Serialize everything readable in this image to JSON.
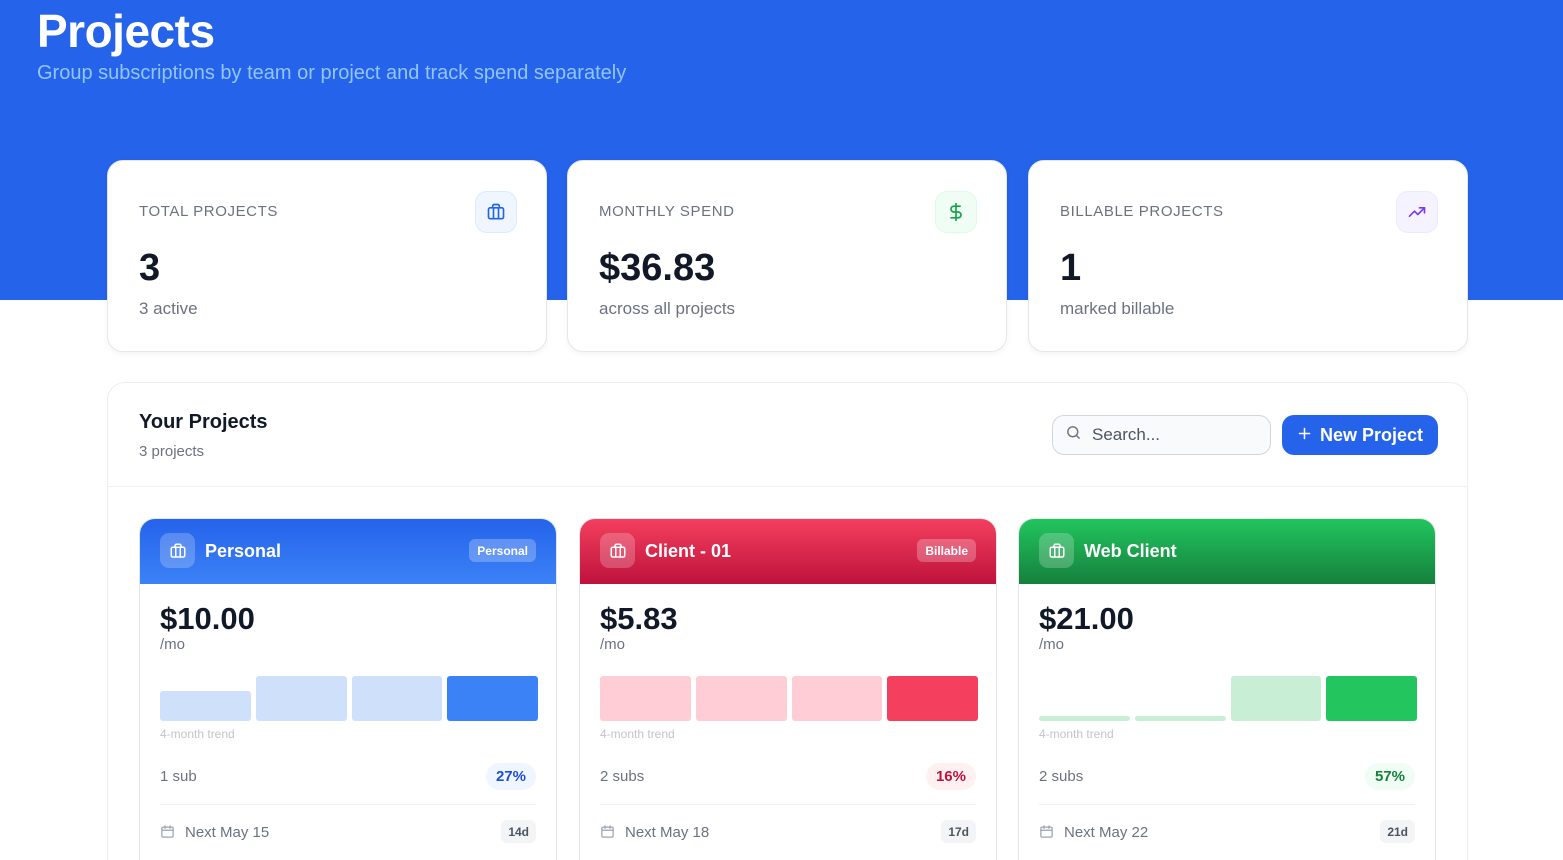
{
  "header": {
    "title": "Projects",
    "subtitle": "Group subscriptions by team or project and track spend separately"
  },
  "stats": [
    {
      "label": "TOTAL PROJECTS",
      "value": "3",
      "note": "3 active",
      "icon": "briefcase-icon",
      "color": "#2563eb"
    },
    {
      "label": "MONTHLY SPEND",
      "value": "$36.83",
      "note": "across all projects",
      "icon": "dollar-icon",
      "color": "#16a34a"
    },
    {
      "label": "BILLABLE PROJECTS",
      "value": "1",
      "note": "marked billable",
      "icon": "trending-up-icon",
      "color": "#7c3aed"
    }
  ],
  "panel": {
    "title": "Your Projects",
    "count": "3 projects",
    "search_placeholder": "Search...",
    "new_button": "New Project"
  },
  "projects": [
    {
      "name": "Personal",
      "tag": "Personal",
      "price": "$10.00",
      "per": "/mo",
      "trend_label": "4-month trend",
      "trend": [
        0.67,
        1.0,
        1.0,
        1.0
      ],
      "subs": "1 sub",
      "pct": "27%",
      "next": "Next May 15",
      "days": "14d",
      "colors": {
        "head_from": "#2563eb",
        "head_to": "#3b82f6",
        "bar_light": "#cfe0fb",
        "bar_strong": "#3b82f6",
        "pct_bg": "#eff6ff",
        "pct_text": "#1d4ed8"
      }
    },
    {
      "name": "Client - 01",
      "tag": "Billable",
      "price": "$5.83",
      "per": "/mo",
      "trend_label": "4-month trend",
      "trend": [
        1.0,
        1.0,
        1.0,
        1.0
      ],
      "subs": "2 subs",
      "pct": "16%",
      "next": "Next May 18",
      "days": "17d",
      "colors": {
        "head_from": "#f43f5e",
        "head_to": "#be123c",
        "bar_light": "#fecdd5",
        "bar_strong": "#f43f5e",
        "pct_bg": "#fff1f2",
        "pct_text": "#be123c"
      }
    },
    {
      "name": "Web Client",
      "tag": "",
      "price": "$21.00",
      "per": "/mo",
      "trend_label": "4-month trend",
      "trend": [
        0.1,
        0.1,
        1.0,
        1.0
      ],
      "subs": "2 subs",
      "pct": "57%",
      "next": "Next May 22",
      "days": "21d",
      "colors": {
        "head_from": "#22c55e",
        "head_to": "#15803d",
        "bar_light": "#c8efd6",
        "bar_strong": "#22c55e",
        "pct_bg": "#f0fdf4",
        "pct_text": "#15803d"
      }
    }
  ]
}
